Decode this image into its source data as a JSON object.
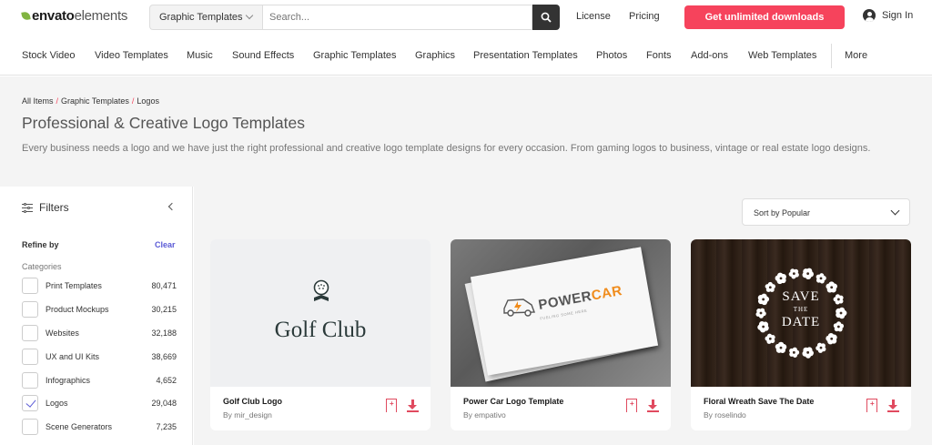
{
  "brand": {
    "part1": "envato",
    "part2": "elements"
  },
  "header": {
    "category_select": "Graphic Templates",
    "search_placeholder": "Search...",
    "license": "License",
    "pricing": "Pricing",
    "cta": "Get unlimited downloads",
    "signin": "Sign In"
  },
  "nav": [
    "Stock Video",
    "Video Templates",
    "Music",
    "Sound Effects",
    "Graphic Templates",
    "Graphics",
    "Presentation Templates",
    "Photos",
    "Fonts",
    "Add-ons",
    "Web Templates",
    "More"
  ],
  "breadcrumb": [
    "All Items",
    "Graphic Templates",
    "Logos"
  ],
  "page": {
    "title": "Professional & Creative Logo Templates",
    "description": "Every business needs a logo and we have just the right professional and creative logo template designs for every occasion. From gaming logos to business, vintage or real estate logo designs."
  },
  "filters": {
    "title": "Filters",
    "refine_by": "Refine by",
    "clear": "Clear",
    "categories_label": "Categories",
    "items": [
      {
        "label": "Print Templates",
        "count": "80,471",
        "checked": false
      },
      {
        "label": "Product Mockups",
        "count": "30,215",
        "checked": false
      },
      {
        "label": "Websites",
        "count": "32,188",
        "checked": false
      },
      {
        "label": "UX and UI Kits",
        "count": "38,669",
        "checked": false
      },
      {
        "label": "Infographics",
        "count": "4,652",
        "checked": false
      },
      {
        "label": "Logos",
        "count": "29,048",
        "checked": true
      },
      {
        "label": "Scene Generators",
        "count": "7,235",
        "checked": false
      }
    ]
  },
  "sort": "Sort by Popular",
  "cards": [
    {
      "title": "Golf Club Logo",
      "author": "By mir_design",
      "thumb_text": "Golf Club"
    },
    {
      "title": "Power Car Logo Template",
      "author": "By empativo",
      "thumb_text_a": "POWER",
      "thumb_text_b": "CAR",
      "thumb_sub": "FUELING SOME HERE"
    },
    {
      "title": "Floral Wreath Save The Date",
      "author": "By roselindo",
      "thumb_line1": "SAVE",
      "thumb_line2": "THE",
      "thumb_line3": "DATE"
    }
  ],
  "colors": {
    "accent": "#f6435c",
    "brand_green": "#81b441",
    "link": "#5b5bd6",
    "icon_red": "#e04a5f"
  }
}
